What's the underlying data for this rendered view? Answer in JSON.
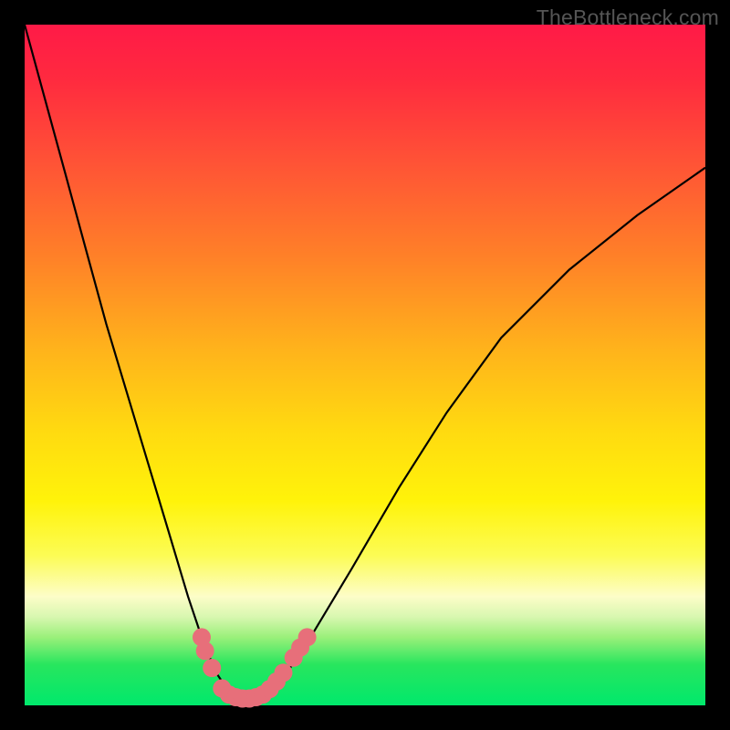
{
  "watermark": "TheBottleneck.com",
  "chart_data": {
    "type": "line",
    "title": "",
    "xlabel": "",
    "ylabel": "",
    "xlim": [
      0,
      100
    ],
    "ylim": [
      0,
      100
    ],
    "grid": false,
    "series": [
      {
        "name": "bottleneck-curve",
        "color": "#000000",
        "x": [
          0,
          3,
          6,
          9,
          12,
          15,
          18,
          21,
          24,
          26,
          28,
          30,
          32,
          34,
          36,
          38,
          42,
          48,
          55,
          62,
          70,
          80,
          90,
          100
        ],
        "y": [
          100,
          89,
          78,
          67,
          56,
          46,
          36,
          26,
          16,
          10,
          5,
          2,
          1,
          1,
          2,
          4,
          10,
          20,
          32,
          43,
          54,
          64,
          72,
          79
        ]
      }
    ],
    "markers": {
      "name": "highlight-points",
      "color": "#e76f7a",
      "points": [
        {
          "x": 26.0,
          "y": 10.0
        },
        {
          "x": 26.5,
          "y": 8.0
        },
        {
          "x": 27.5,
          "y": 5.5
        },
        {
          "x": 29.0,
          "y": 2.5
        },
        {
          "x": 30.0,
          "y": 1.6
        },
        {
          "x": 31.0,
          "y": 1.2
        },
        {
          "x": 32.0,
          "y": 1.0
        },
        {
          "x": 33.0,
          "y": 1.0
        },
        {
          "x": 34.0,
          "y": 1.2
        },
        {
          "x": 35.0,
          "y": 1.6
        },
        {
          "x": 36.0,
          "y": 2.4
        },
        {
          "x": 37.0,
          "y": 3.5
        },
        {
          "x": 38.0,
          "y": 4.8
        },
        {
          "x": 39.5,
          "y": 7.0
        },
        {
          "x": 40.5,
          "y": 8.5
        },
        {
          "x": 41.5,
          "y": 10.0
        }
      ]
    }
  }
}
